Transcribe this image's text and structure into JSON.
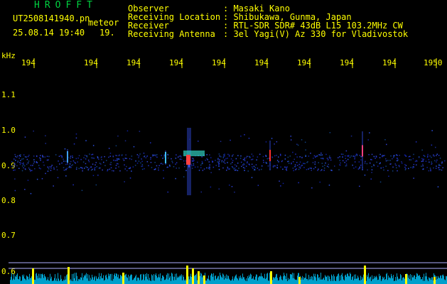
{
  "header": {
    "brand": "HROFFT",
    "filename": "UT2508141940.pn",
    "meteor_tag": "meteor",
    "datetime": "25.08.14 19:40",
    "short_time": "19.",
    "fields": [
      {
        "label": "Observer",
        "value": ": Masaki Kano"
      },
      {
        "label": "Receiving Location",
        "value": ": Shibukawa, Gunma, Japan"
      },
      {
        "label": "Receiver",
        "value": ": RTL-SDR SDR# 43dB L15 103.2MHz CW"
      },
      {
        "label": "Receiving Antenna",
        "value": ": 3el Yagi(V) Az 330 for Vladivostok"
      }
    ]
  },
  "axes": {
    "y_unit": "kHz",
    "y_ticks": [
      "1.1",
      "1.0",
      "0.9",
      "0.8",
      "0.7",
      "0.6"
    ],
    "x_ticks": [
      "194",
      "194",
      "194",
      "194",
      "194",
      "194",
      "194",
      "194",
      "194",
      "1950"
    ]
  },
  "colors": {
    "background": "#000000",
    "text": "#ffff00",
    "brand": "#00d040",
    "signal_cyan": "#00c8ff",
    "signal_yellow": "#ffff00"
  }
}
